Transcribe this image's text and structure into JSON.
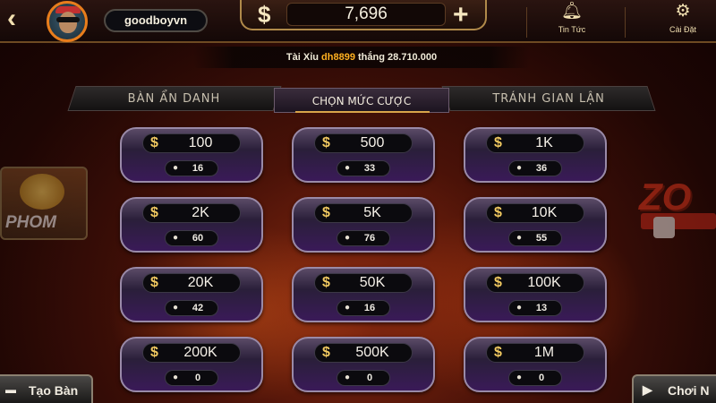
{
  "header": {
    "back_icon": "chevron-left-icon",
    "username": "goodboyvn",
    "currency_symbol": "$",
    "balance": "7,696",
    "add_icon": "plus-icon",
    "news_label": "Tin Tức",
    "news_icon": "bell-icon",
    "settings_label": "Cài Đặt",
    "settings_icon": "gear-icon"
  },
  "ticker": {
    "game": "Tài Xỉu",
    "winner": "dh8899",
    "verb": "thắng",
    "amount": "28.710.000"
  },
  "tabs": [
    {
      "label": "BÀN ẨN DANH",
      "active": false
    },
    {
      "label": "CHỌN MỨC CƯỢC",
      "active": true
    },
    {
      "label": "TRÁNH GIAN LẬN",
      "active": false
    }
  ],
  "bets": [
    {
      "amount": "100",
      "players": "16"
    },
    {
      "amount": "500",
      "players": "33"
    },
    {
      "amount": "1K",
      "players": "36"
    },
    {
      "amount": "2K",
      "players": "60"
    },
    {
      "amount": "5K",
      "players": "76"
    },
    {
      "amount": "10K",
      "players": "55"
    },
    {
      "amount": "20K",
      "players": "42"
    },
    {
      "amount": "50K",
      "players": "16"
    },
    {
      "amount": "100K",
      "players": "13"
    },
    {
      "amount": "200K",
      "players": "0"
    },
    {
      "amount": "500K",
      "players": "0"
    },
    {
      "amount": "1M",
      "players": "0"
    }
  ],
  "side": {
    "left_banner": "PHOM",
    "right_banner": "ZO"
  },
  "footer": {
    "create_label": "Tạo Bàn",
    "play_label": "Chơi N"
  },
  "colors": {
    "accent_gold": "#f0c860",
    "ticker_highlight": "#ffb020",
    "bet_purple": "#3a1a58"
  }
}
